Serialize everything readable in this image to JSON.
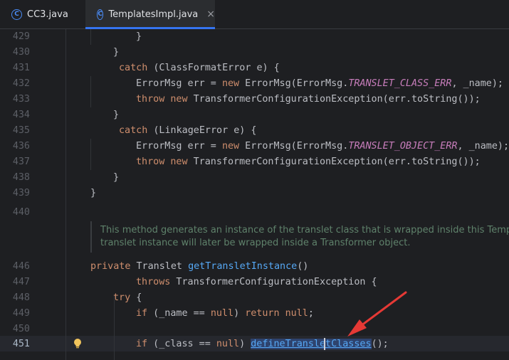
{
  "tabs": [
    {
      "label": "CC3.java",
      "icon": "class-icon"
    },
    {
      "label": "TemplatesImpl.java",
      "icon": "class-icon",
      "close": "×"
    }
  ],
  "gutter": [
    "429",
    "430",
    "431",
    "432",
    "433",
    "434",
    "435",
    "436",
    "437",
    "438",
    "439",
    "440",
    "446",
    "447",
    "448",
    "449",
    "450",
    "451"
  ],
  "code": {
    "l429": "}",
    "l430": "}",
    "l431_kw": "catch",
    "l431_rest": " (ClassFormatError e) {",
    "l432_a": "ErrorMsg err = ",
    "l432_kw": "new",
    "l432_b": " ErrorMsg(ErrorMsg.",
    "l432_const": "TRANSLET_CLASS_ERR",
    "l432_c": ", _name);",
    "l433_kw1": "throw",
    "l433_kw2": "new",
    "l433_rest": " TransformerConfigurationException(err.toString());",
    "l434": "}",
    "l435_kw": "catch",
    "l435_rest": " (LinkageError e) {",
    "l436_a": "ErrorMsg err = ",
    "l436_kw": "new",
    "l436_b": " ErrorMsg(ErrorMsg.",
    "l436_const": "TRANSLET_OBJECT_ERR",
    "l436_c": ", _name);",
    "l437_kw1": "throw",
    "l437_kw2": "new",
    "l437_rest": " TransformerConfigurationException(err.toString());",
    "l438": "}",
    "l439": "}",
    "doc1": "This method generates an instance of the translet class that is wrapped inside this Templat",
    "doc2": "translet instance will later be wrapped inside a Transformer object.",
    "l446_kw": "private",
    "l446_type": " Translet ",
    "l446_fn": "getTransletInstance",
    "l446_rest": "()",
    "l447_kw": "throws",
    "l447_rest": " TransformerConfigurationException {",
    "l448_kw": "try",
    "l448_rest": " {",
    "l449_kw1": "if",
    "l449_a": " (_name == ",
    "l449_kw2": "null",
    "l449_b": ") ",
    "l449_kw3": "return",
    "l449_kw4": "null",
    "l449_c": ";",
    "l451_kw1": "if",
    "l451_a": " (_class == ",
    "l451_kw2": "null",
    "l451_b": ") ",
    "l451_fn_a": "defineTranslet",
    "l451_fn_b": "Classes",
    "l451_c": "();"
  },
  "colors": {
    "keyword": "#cf8e6d",
    "function": "#56a8f5",
    "constant": "#c77dbb",
    "doc_comment": "#5f826b",
    "annotation_arrow": "#e53935"
  }
}
